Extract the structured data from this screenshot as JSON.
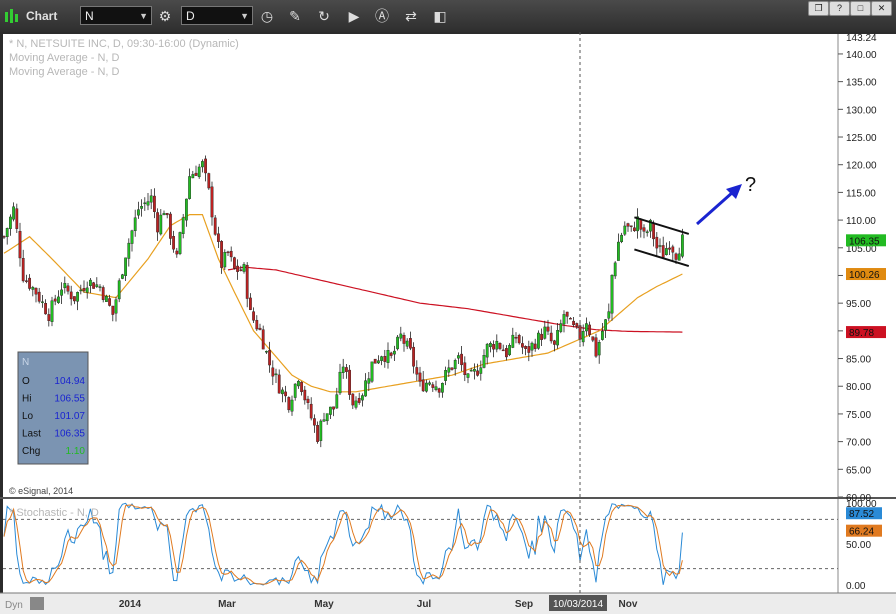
{
  "window": {
    "title": "Chart",
    "symbol": "N",
    "interval": "D",
    "footer_left": "Dyn"
  },
  "legend": {
    "line1": "* N, NETSUITE INC, D, 09:30-16:00 (Dynamic)",
    "line2": "Moving Average - N, D",
    "line3": "Moving Average - N, D",
    "copyright": "© eSignal, 2014",
    "stoch_label": "* Stochastic - N, D"
  },
  "databox": {
    "symbol": "N",
    "rows": [
      {
        "label": "O",
        "value": "104.94"
      },
      {
        "label": "Hi",
        "value": "106.55"
      },
      {
        "label": "Lo",
        "value": "101.07"
      },
      {
        "label": "Last",
        "value": "106.35"
      },
      {
        "label": "Chg",
        "value": "1.10"
      }
    ]
  },
  "colors": {
    "up": "#22bb22",
    "down": "#bb2222",
    "ma_short": "#e8a020",
    "ma_long": "#cc1122",
    "stoch_k": "#2a8ad6",
    "stoch_d": "#e07a20",
    "arrow": "#1a24d0"
  },
  "chart_data": {
    "type": "candlestick",
    "x_ticks": [
      "2014",
      "Mar",
      "May",
      "Jul",
      "Sep",
      "Nov"
    ],
    "cursor_date": "10/03/2014",
    "price_axis": {
      "ylim": [
        60,
        143.24
      ],
      "ticks": [
        "140.00",
        "135.00",
        "130.00",
        "125.00",
        "120.00",
        "115.00",
        "110.00",
        "105.00",
        "100.00",
        "95.00",
        "90.00",
        "85.00",
        "80.00",
        "75.00",
        "70.00",
        "65.00",
        "60.00"
      ],
      "top_label": "143.24"
    },
    "price_labels": [
      {
        "value": 106.35,
        "text": "106.35",
        "color": "#22bb22"
      },
      {
        "value": 100.26,
        "text": "100.26",
        "color": "#e08a10"
      },
      {
        "value": 89.78,
        "text": "89.78",
        "color": "#cc1122"
      }
    ],
    "price_anchors": [
      [
        0,
        107
      ],
      [
        3,
        112
      ],
      [
        6,
        100
      ],
      [
        10,
        97
      ],
      [
        14,
        93
      ],
      [
        18,
        98
      ],
      [
        22,
        96
      ],
      [
        26,
        99
      ],
      [
        30,
        98
      ],
      [
        34,
        93
      ],
      [
        38,
        104
      ],
      [
        42,
        112
      ],
      [
        46,
        114
      ],
      [
        48,
        109
      ],
      [
        50,
        112
      ],
      [
        54,
        103
      ],
      [
        58,
        118
      ],
      [
        62,
        120
      ],
      [
        64,
        115
      ],
      [
        66,
        108
      ],
      [
        68,
        102
      ],
      [
        70,
        104
      ],
      [
        72,
        101
      ],
      [
        75,
        101
      ],
      [
        77,
        93
      ],
      [
        80,
        90
      ],
      [
        83,
        84
      ],
      [
        86,
        80
      ],
      [
        89,
        77
      ],
      [
        92,
        82
      ],
      [
        95,
        76
      ],
      [
        98,
        71
      ],
      [
        100,
        75
      ],
      [
        103,
        76
      ],
      [
        106,
        84
      ],
      [
        109,
        77
      ],
      [
        112,
        79
      ],
      [
        115,
        84
      ],
      [
        118,
        86
      ],
      [
        121,
        85
      ],
      [
        124,
        89
      ],
      [
        127,
        86
      ],
      [
        130,
        80
      ],
      [
        133,
        81
      ],
      [
        136,
        80
      ],
      [
        139,
        83
      ],
      [
        142,
        85
      ],
      [
        145,
        81
      ],
      [
        148,
        83
      ],
      [
        151,
        87
      ],
      [
        154,
        88
      ],
      [
        157,
        86
      ],
      [
        160,
        89
      ],
      [
        163,
        86
      ],
      [
        166,
        88
      ],
      [
        169,
        90
      ],
      [
        172,
        87
      ],
      [
        175,
        93
      ],
      [
        177,
        91
      ],
      [
        180,
        89
      ],
      [
        182,
        92
      ],
      [
        185,
        86
      ],
      [
        187,
        90
      ],
      [
        189,
        93
      ],
      [
        190,
        100
      ],
      [
        192,
        106
      ],
      [
        194,
        109
      ],
      [
        196,
        108
      ],
      [
        198,
        110
      ],
      [
        200,
        107
      ],
      [
        202,
        109
      ],
      [
        204,
        105
      ],
      [
        206,
        104
      ],
      [
        208,
        106
      ],
      [
        210,
        104
      ],
      [
        212,
        106.35
      ]
    ],
    "ma_short_anchors": [
      [
        0,
        104
      ],
      [
        8,
        107
      ],
      [
        15,
        103
      ],
      [
        25,
        97
      ],
      [
        35,
        96
      ],
      [
        45,
        103
      ],
      [
        52,
        109
      ],
      [
        58,
        111
      ],
      [
        62,
        111
      ],
      [
        67,
        103
      ],
      [
        72,
        97
      ],
      [
        78,
        90
      ],
      [
        84,
        86
      ],
      [
        90,
        82
      ],
      [
        96,
        80
      ],
      [
        102,
        79
      ],
      [
        110,
        79
      ],
      [
        120,
        80
      ],
      [
        130,
        81
      ],
      [
        140,
        82
      ],
      [
        150,
        84
      ],
      [
        160,
        85
      ],
      [
        170,
        86
      ],
      [
        178,
        88
      ],
      [
        186,
        90
      ],
      [
        192,
        93
      ],
      [
        198,
        96
      ],
      [
        204,
        98
      ],
      [
        212,
        100.26
      ]
    ],
    "ma_long_anchors": [
      [
        70,
        101
      ],
      [
        75,
        101.5
      ],
      [
        85,
        101
      ],
      [
        100,
        99
      ],
      [
        115,
        97
      ],
      [
        130,
        95
      ],
      [
        145,
        94
      ],
      [
        160,
        92.5
      ],
      [
        175,
        91
      ],
      [
        185,
        90.2
      ],
      [
        195,
        89.9
      ],
      [
        212,
        89.78
      ]
    ],
    "stoch_axis": {
      "ylim": [
        0,
        100
      ],
      "ticks": [
        "100.00",
        "50.00",
        "0.00"
      ],
      "levels": [
        80,
        20
      ]
    },
    "stoch_labels": [
      {
        "value": 87.52,
        "text": "87.52",
        "color": "#2a8ad6"
      },
      {
        "value": 66.24,
        "text": "66.24",
        "color": "#e07a20"
      }
    ],
    "channel": {
      "upper": [
        [
          197,
          110.5
        ],
        [
          214,
          107.5
        ]
      ],
      "lower": [
        [
          197,
          104.7
        ],
        [
          214,
          101.7
        ]
      ]
    },
    "annotation": {
      "text": "?"
    }
  }
}
